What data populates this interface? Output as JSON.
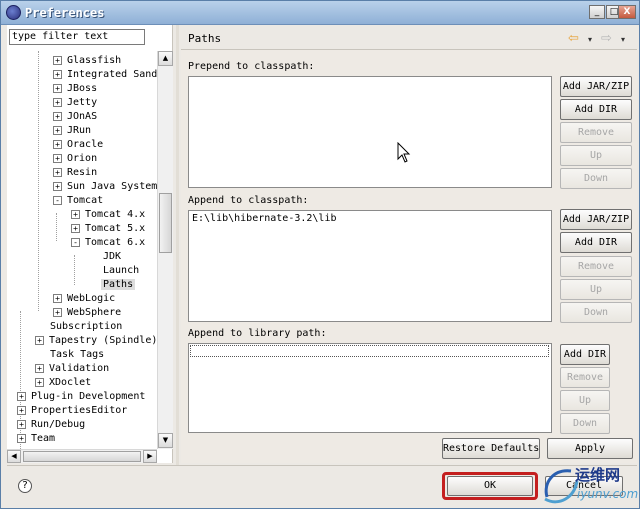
{
  "window": {
    "title": "Preferences"
  },
  "title_buttons": {
    "minimize": "_",
    "maximize": "□",
    "close": "X"
  },
  "filter": {
    "value": "type filter text"
  },
  "tree": {
    "items": [
      {
        "label": "Glassfish",
        "expander": "+"
      },
      {
        "label": "Integrated Sandb",
        "expander": "+"
      },
      {
        "label": "JBoss",
        "expander": "+"
      },
      {
        "label": "Jetty",
        "expander": "+"
      },
      {
        "label": "JOnAS",
        "expander": "+"
      },
      {
        "label": "JRun",
        "expander": "+"
      },
      {
        "label": "Oracle",
        "expander": "+"
      },
      {
        "label": "Orion",
        "expander": "+"
      },
      {
        "label": "Resin",
        "expander": "+"
      },
      {
        "label": "Sun Java System",
        "expander": "+"
      },
      {
        "label": "Tomcat",
        "expander": "-"
      },
      {
        "label": "Tomcat  4.x",
        "expander": "+"
      },
      {
        "label": "Tomcat  5.x",
        "expander": "+"
      },
      {
        "label": "Tomcat  6.x",
        "expander": "-"
      },
      {
        "label": "JDK",
        "expander": ""
      },
      {
        "label": "Launch",
        "expander": ""
      },
      {
        "label": "Paths",
        "expander": ""
      },
      {
        "label": "WebLogic",
        "expander": "+"
      },
      {
        "label": "WebSphere",
        "expander": "+"
      },
      {
        "label": "Subscription",
        "expander": ""
      },
      {
        "label": "Tapestry (Spindle)",
        "expander": "+"
      },
      {
        "label": "Task Tags",
        "expander": ""
      },
      {
        "label": "Validation",
        "expander": "+"
      },
      {
        "label": "XDoclet",
        "expander": "+"
      },
      {
        "label": "Plug-in Development",
        "expander": "+"
      },
      {
        "label": "PropertiesEditor",
        "expander": "+"
      },
      {
        "label": "Run/Debug",
        "expander": "+"
      },
      {
        "label": "Team",
        "expander": "+"
      }
    ]
  },
  "scroll_glyphs": {
    "up": "▲",
    "down": "▼",
    "left": "◀",
    "right": "▶"
  },
  "page": {
    "title": "Paths",
    "nav_back": "⇦",
    "nav_forward": "⇨",
    "nav_dropdown": "▾"
  },
  "sections": {
    "prepend": {
      "label": "Prepend to classpath:",
      "entries": []
    },
    "append": {
      "label": "Append to classpath:",
      "entries": [
        "E:\\lib\\hibernate-3.2\\lib"
      ]
    },
    "library": {
      "label": "Append to library path:",
      "entries": []
    }
  },
  "buttons": {
    "add_jar_zip": "Add JAR/ZIP",
    "add_dir": "Add DIR",
    "remove": "Remove",
    "up": "Up",
    "down": "Down",
    "restore_defaults": "Restore Defaults",
    "apply": "Apply",
    "ok": "OK",
    "cancel": "Cancel"
  },
  "help": {
    "icon": "?"
  },
  "watermark": {
    "line1": "运维网",
    "line2": "iyunv.com"
  },
  "colors": {
    "title_bar": "#8fb0d6",
    "highlight": "#c41f1f",
    "watermark_blue": "#1e3a8a",
    "watermark_light": "#4e9fd0"
  }
}
